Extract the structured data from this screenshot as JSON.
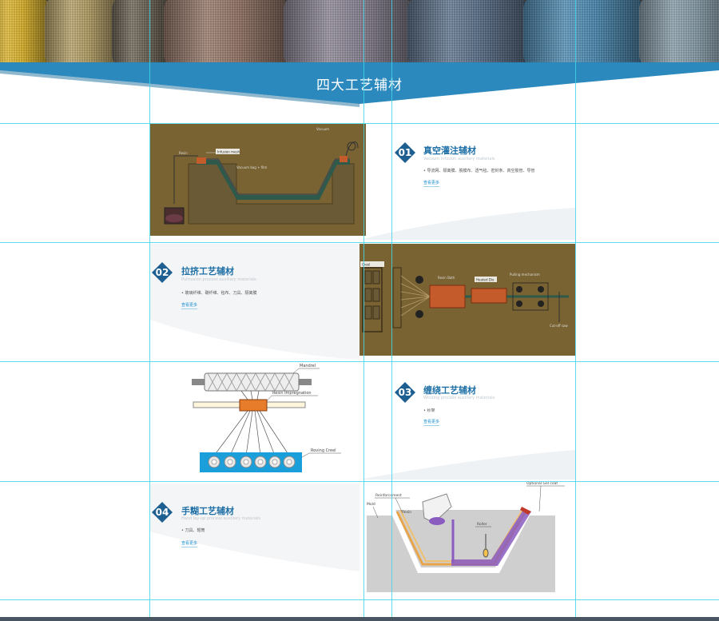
{
  "banner": {
    "title": "四大工艺辅材"
  },
  "colors": {
    "accent": "#2a8bbf",
    "badge": "#1d5f91",
    "guide": "#3fd6ea",
    "diagram_bg": "#7a6332"
  },
  "sections": [
    {
      "number": "01",
      "title": "真空灌注辅材",
      "subtitle": "Vacuum infusion auxiliary materials",
      "items": "• 导流网、隔离膜、脱模布、透气毡、密封条、真空胶管、导管",
      "more": "查看更多"
    },
    {
      "number": "02",
      "title": "拉挤工艺辅材",
      "subtitle": "Pultrusion process auxiliary materials",
      "items": "• 玻璃纤维、碳纤维、毡布、刀具、隔离膜",
      "more": "查看更多"
    },
    {
      "number": "03",
      "title": "缠绕工艺辅材",
      "subtitle": "Winding process auxiliary materials",
      "items": "• 纱架",
      "more": "查看更多"
    },
    {
      "number": "04",
      "title": "手糊工艺辅材",
      "subtitle": "Hand lay-up process auxiliary materials",
      "items": "• 刀具、辊筒",
      "more": "查看更多"
    }
  ],
  "diagram_labels": {
    "infusion_resin": "Resin",
    "infusion_peel": "Infusion mesh",
    "infusion_vacuum": "Vacuum bag + film",
    "infusion_pump": "Vacuum",
    "pultrusion_creel": "Creel",
    "pultrusion_resin": "Resin Bath",
    "pultrusion_die": "Heated Die",
    "pultrusion_pull": "Pulling mechanism",
    "pultrusion_saw": "Cut-off saw",
    "winding_mandrel": "Mandrel",
    "winding_resin": "Resin Impregnation",
    "winding_creel": "Roving Creel",
    "layup_gelcoat": "Optional Gel coat",
    "layup_reinforcement": "Reinforcement",
    "layup_resin": "Resin",
    "layup_mold": "Mold",
    "layup_roller": "Roller"
  }
}
